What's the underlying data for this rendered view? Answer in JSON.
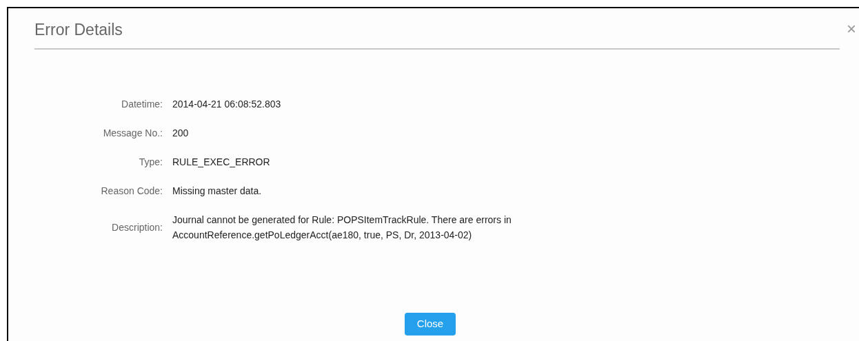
{
  "dialog": {
    "title": "Error Details",
    "close_icon": "×",
    "fields": [
      {
        "label": "Datetime:",
        "value": "2014-04-21 06:08:52.803"
      },
      {
        "label": "Message No.:",
        "value": "200"
      },
      {
        "label": "Type:",
        "value": "RULE_EXEC_ERROR"
      },
      {
        "label": "Reason Code:",
        "value": "Missing master data."
      },
      {
        "label": "Description:",
        "value": "Journal cannot be generated for Rule: POPSItemTrackRule. There are errors in AccountReference.getPoLedgerAcct(ae180, true, PS, Dr, 2013-04-02)"
      }
    ],
    "button": "Close"
  }
}
